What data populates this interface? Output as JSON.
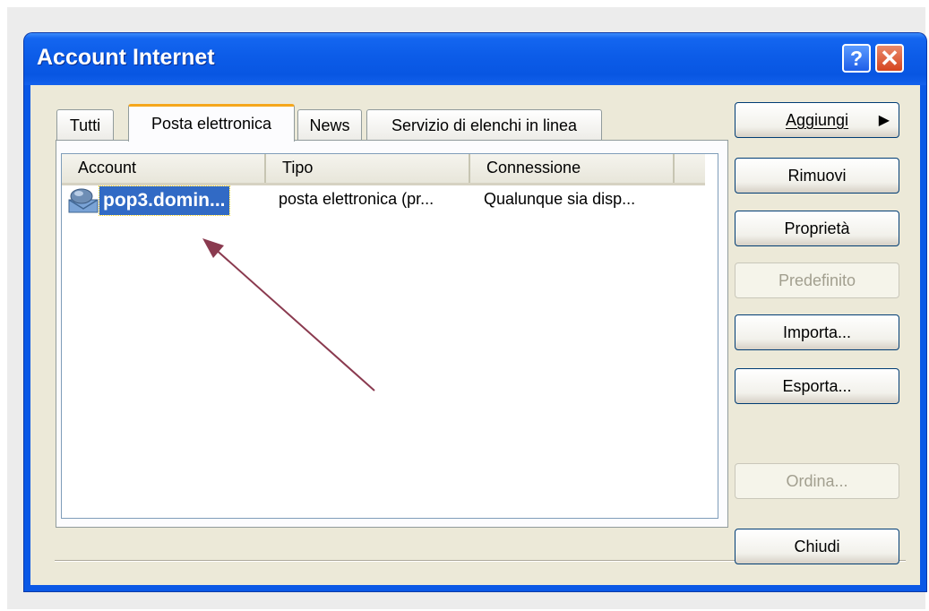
{
  "window": {
    "title": "Account Internet"
  },
  "tabs": [
    {
      "label": "Tutti"
    },
    {
      "label": "Posta elettronica",
      "active": true
    },
    {
      "label": "News"
    },
    {
      "label": "Servizio di elenchi in linea"
    }
  ],
  "list": {
    "columns": [
      "Account",
      "Tipo",
      "Connessione"
    ],
    "rows": [
      {
        "account": "pop3.domin...",
        "type": "posta elettronica (pr...",
        "connection": "Qualunque sia disp...",
        "selected": true,
        "icon": "mail-account-icon"
      }
    ]
  },
  "buttons": {
    "add": "Aggiungi",
    "remove": "Rimuovi",
    "properties": "Proprietà",
    "default": "Predefinito",
    "import": "Importa...",
    "export": "Esporta...",
    "order": "Ordina...",
    "close": "Chiudi"
  },
  "colors": {
    "titlebar": "#0c5ce8",
    "selection": "#316ac5",
    "annotation_arrow": "#8a3a4f"
  }
}
